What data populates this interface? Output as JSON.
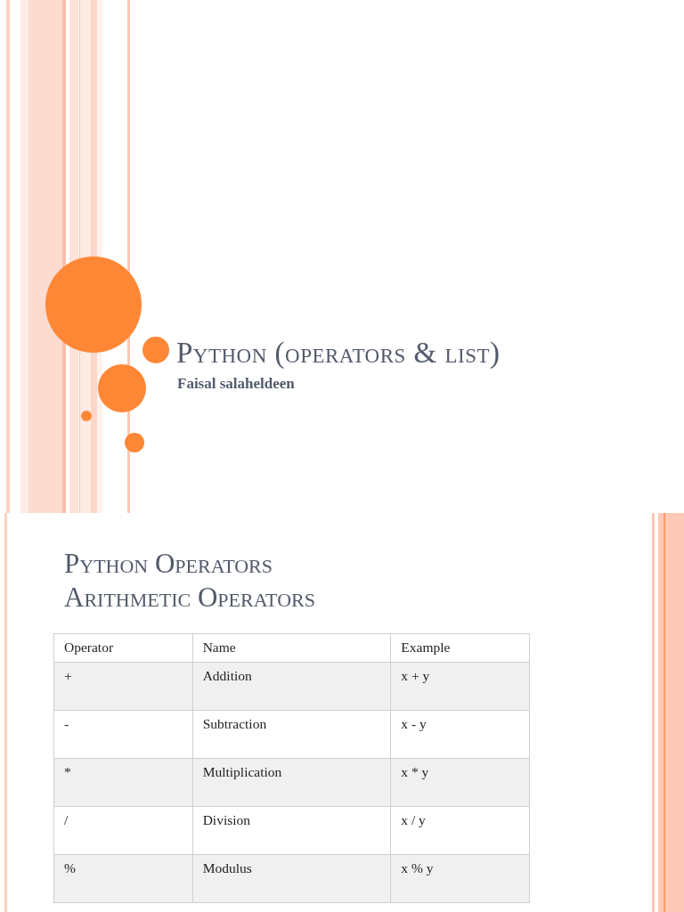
{
  "slides": [
    {
      "kind": "title",
      "title": "Python (operators & list)",
      "subtitle": "Faisal salaheldeen"
    },
    {
      "kind": "table",
      "heading": [
        "Python Operators",
        "Arithmetic Operators"
      ],
      "table": {
        "columns": [
          "Operator",
          "Name",
          "Example"
        ],
        "rows": [
          [
            "+",
            "Addition",
            "x + y"
          ],
          [
            "-",
            "Subtraction",
            "x - y"
          ],
          [
            "*",
            "Multiplication",
            "x * y"
          ],
          [
            "/",
            "Division",
            "x / y"
          ],
          [
            "%",
            "Modulus",
            "x % y"
          ]
        ]
      }
    }
  ]
}
